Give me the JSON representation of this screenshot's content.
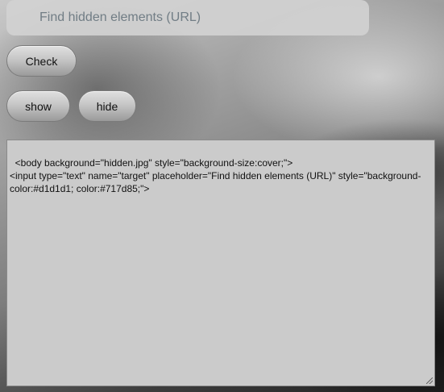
{
  "url_input": {
    "placeholder": "Find hidden elements (URL)",
    "value": ""
  },
  "buttons": {
    "check": "Check",
    "show": "show",
    "hide": "hide"
  },
  "code_area": {
    "text": "<body background=\"hidden.jpg\" style=\"background-size:cover;\">\n<input type=\"text\" name=\"target\" placeholder=\"Find hidden elements (URL)\" style=\"background-color:#d1d1d1; color:#717d85;\">"
  },
  "colors": {
    "input_background": "#d1d1d1",
    "input_text": "#717d85"
  }
}
